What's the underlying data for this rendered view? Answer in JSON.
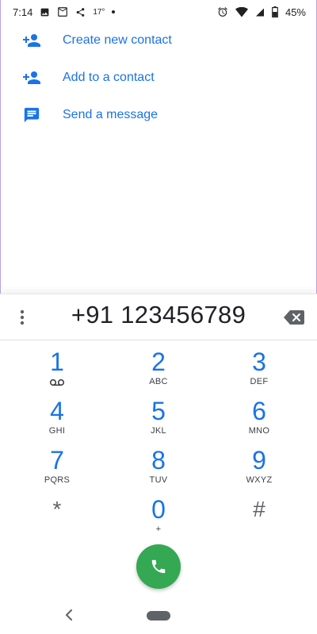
{
  "status_bar": {
    "time": "7:14",
    "temperature": "17°",
    "battery_percent": "45%",
    "left_icons": [
      "image-icon",
      "gmail-icon",
      "share-icon"
    ],
    "right_icons": [
      "alarm-icon",
      "wifi-icon",
      "signal-icon",
      "battery-icon"
    ]
  },
  "actions": [
    {
      "label": "Create new contact",
      "icon": "person-add-icon"
    },
    {
      "label": "Add to a contact",
      "icon": "person-add-icon"
    },
    {
      "label": "Send a message",
      "icon": "message-icon"
    }
  ],
  "dialpad": {
    "number": "+91 123456789",
    "keys": [
      {
        "digit": "1",
        "letters": ""
      },
      {
        "digit": "2",
        "letters": "ABC"
      },
      {
        "digit": "3",
        "letters": "DEF"
      },
      {
        "digit": "4",
        "letters": "GHI"
      },
      {
        "digit": "5",
        "letters": "JKL"
      },
      {
        "digit": "6",
        "letters": "MNO"
      },
      {
        "digit": "7",
        "letters": "PQRS"
      },
      {
        "digit": "8",
        "letters": "TUV"
      },
      {
        "digit": "9",
        "letters": "WXYZ"
      },
      {
        "digit": "*",
        "letters": ""
      },
      {
        "digit": "0",
        "letters": "+"
      },
      {
        "digit": "#",
        "letters": ""
      }
    ]
  },
  "colors": {
    "accent": "#1a73e8",
    "call_button": "#34a853",
    "text_primary": "#202124",
    "text_secondary": "#5f6368"
  }
}
